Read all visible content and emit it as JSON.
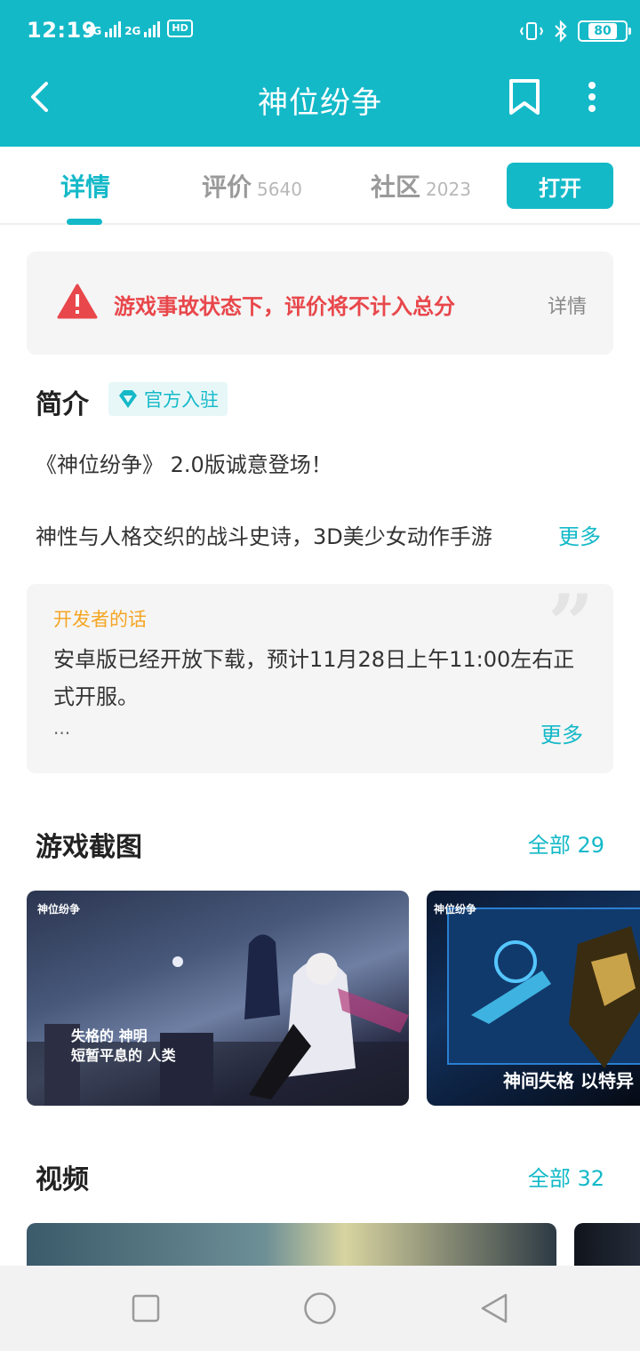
{
  "status_bar": {
    "time": "12:19",
    "net_label_1": "4G",
    "net_label_2": "2G",
    "hd_label": "HD",
    "battery": "80"
  },
  "nav": {
    "title": "神位纷争"
  },
  "tabs": [
    {
      "label": "详情",
      "count": ""
    },
    {
      "label": "评价",
      "count": "5640"
    },
    {
      "label": "社区",
      "count": "2023"
    }
  ],
  "open_button": "打开",
  "warning": {
    "text": "游戏事故状态下，评价将不计入总分",
    "detail": "详情"
  },
  "intro": {
    "title": "简介",
    "badge": "官方入驻",
    "line1": "《神位纷争》 2.0版诚意登场！",
    "line2": "神性与人格交织的战斗史诗，3D美少女动作手游",
    "more": "更多"
  },
  "developer": {
    "title": "开发者的话",
    "text": "安卓版已经开放下载，预计11月28日上午11:00左右正式开服。",
    "ellipsis": "...",
    "more": "更多"
  },
  "screenshots": {
    "title": "游戏截图",
    "all": "全部 29",
    "items": [
      {
        "logo": "神位纷争",
        "caption_a": "失格的 神明",
        "caption_b": "短暂平息的 人类"
      },
      {
        "logo": "神位纷争",
        "caption_a": "神间失格 以特异"
      }
    ]
  },
  "videos": {
    "title": "视频",
    "all": "全部 32"
  },
  "colors": {
    "accent": "#14b9c8",
    "warning": "#e8474b",
    "developer_title": "#f5a623"
  }
}
